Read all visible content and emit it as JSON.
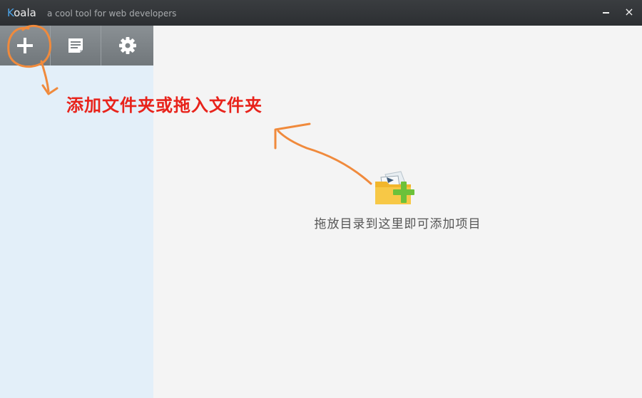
{
  "window": {
    "app_name_first": "K",
    "app_name_rest": "oala",
    "tagline": "a cool tool for web developers",
    "minimize_icon": "minimize-icon",
    "close_glyph": "×"
  },
  "toolbar": {
    "buttons": [
      {
        "name": "add-folder-button",
        "icon": "plus-icon"
      },
      {
        "name": "log-button",
        "icon": "document-icon"
      },
      {
        "name": "settings-button",
        "icon": "gear-icon"
      }
    ]
  },
  "main": {
    "empty_icon": "folder-add-icon",
    "empty_text": "拖放目录到这里即可添加项目"
  },
  "annotation": {
    "text": "添加文件夹或拖入文件夹",
    "color": "#e8231b",
    "stroke_color": "#f08a3c"
  },
  "colors": {
    "titlebar": "#2e3134",
    "sidebar": "#e3eff9",
    "toolbar": "#7d8387",
    "main_bg": "#f4f4f4",
    "accent": "#4aa3e8"
  }
}
